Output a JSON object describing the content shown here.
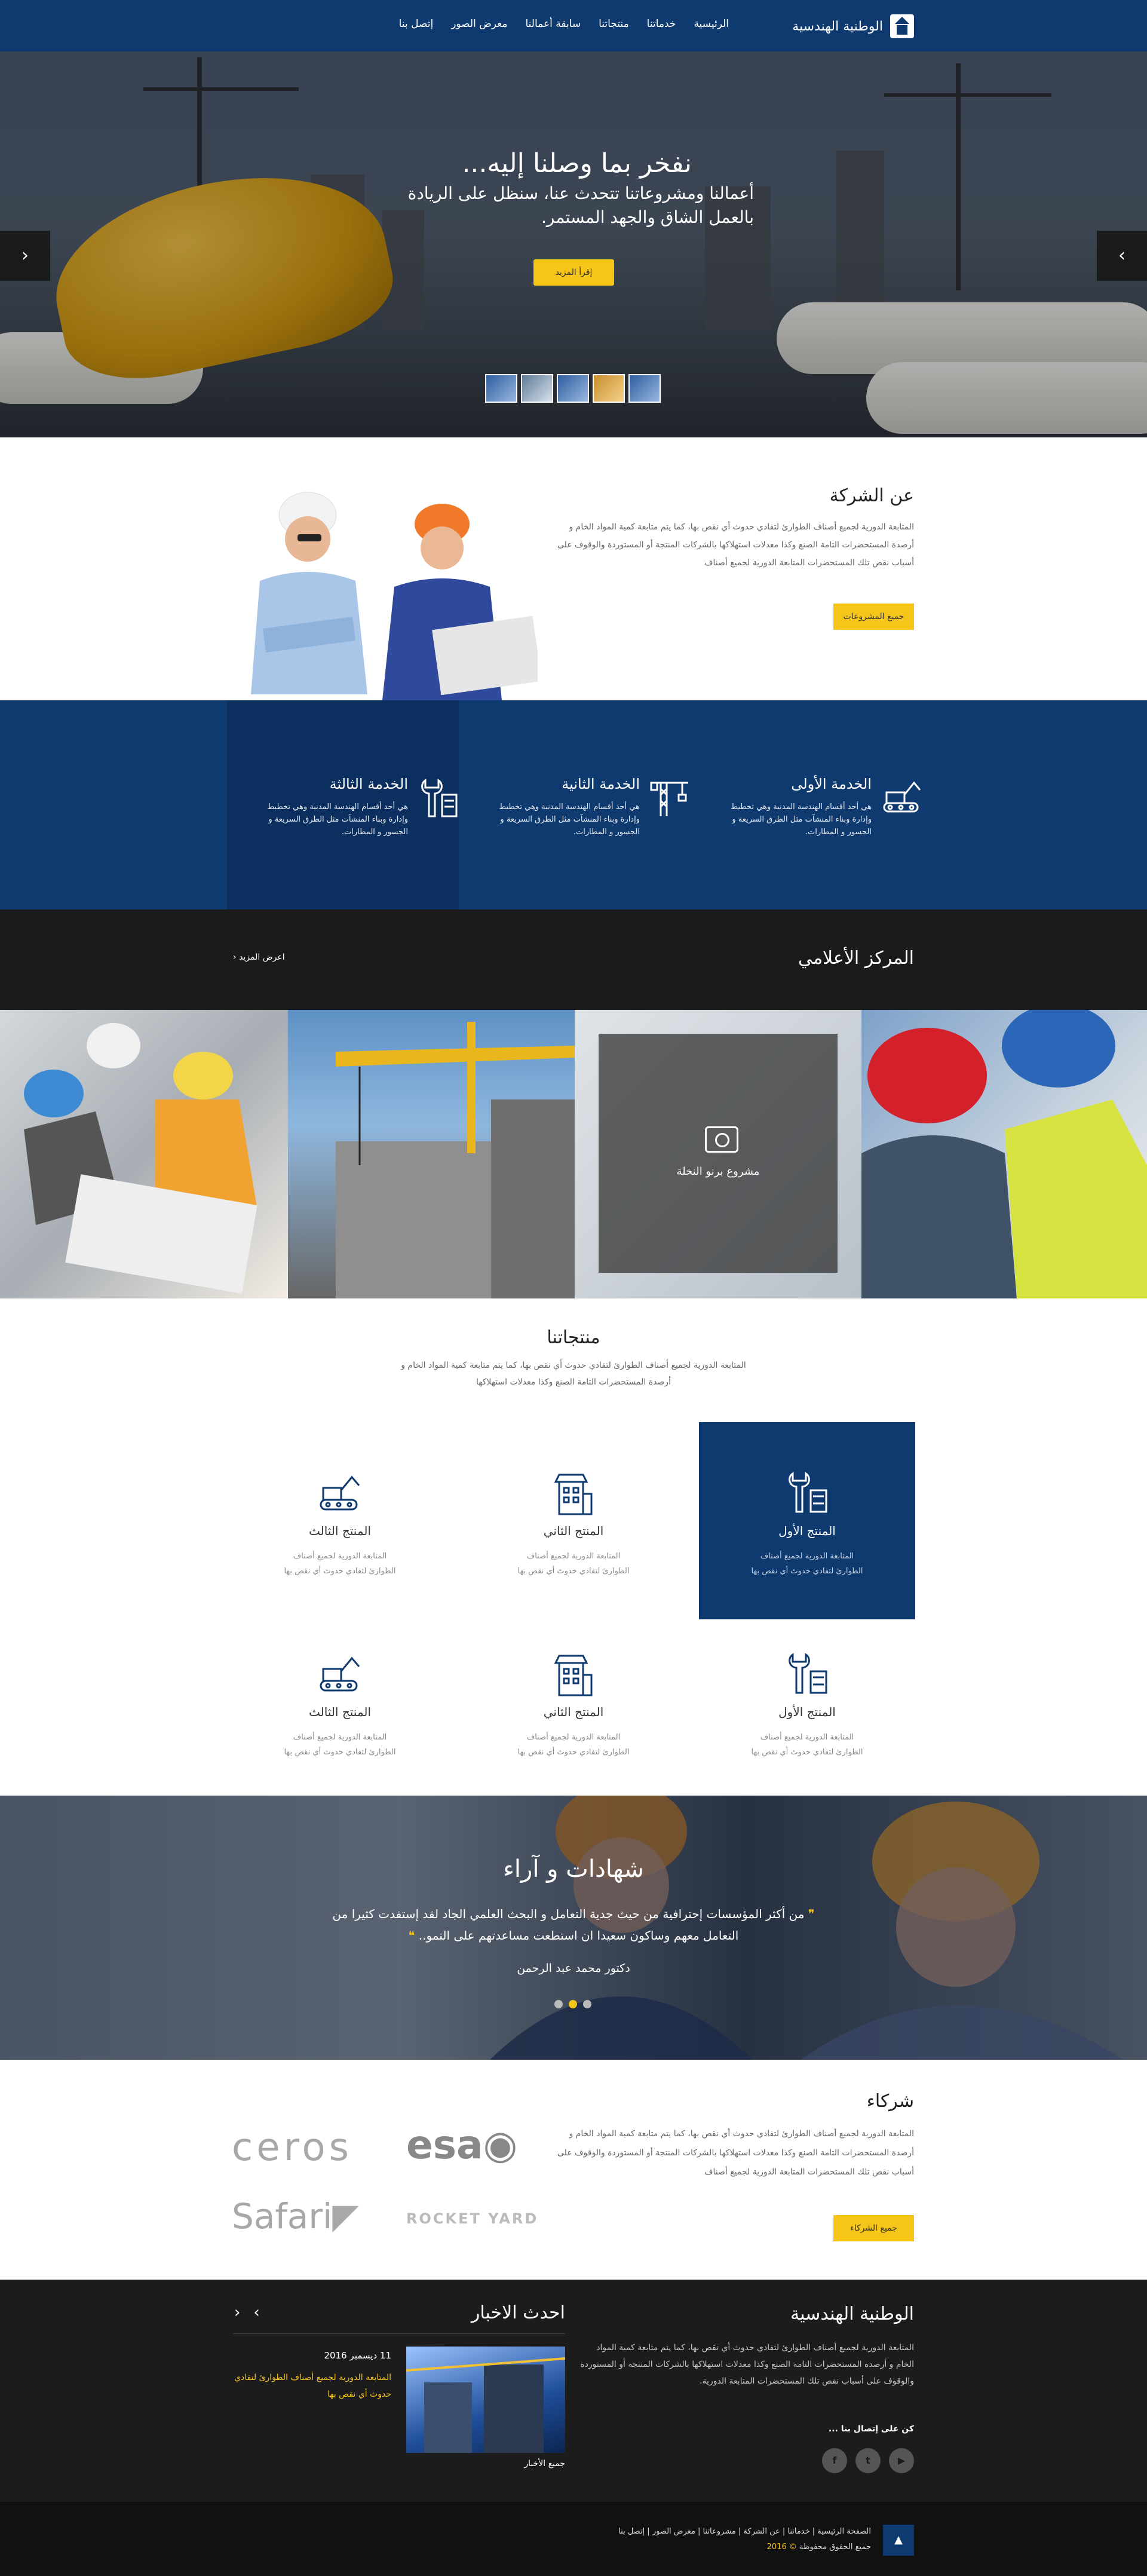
{
  "nav": {
    "brand": "الوطنية الهندسية",
    "items": [
      "الرئيسية",
      "خدماتنا",
      "منتجاتنا",
      "سابقة أعمالنا",
      "معرض الصور",
      "إتصل بنا"
    ]
  },
  "hero": {
    "title": "نفخر بما وصلنا إليه...",
    "subtitle": "أعمالنا ومشروعاتنا تتحدث عنا، سنظل على الريادة بالعمل الشاق والجهد المستمر.",
    "button": "إقرأ المزيد",
    "arrow_prev": "‹",
    "arrow_next": "›"
  },
  "about": {
    "title": "عن الشركة",
    "text": "المتابعة الدورية لجميع أصناف الطوارئ لتفادي حدوث أي نقص بها، كما يتم متابعة كمية المواد الخام و أرصدة المستحضرات التامة الصنع وكذا معدلات استهلاكها بالشركات المنتجة أو المستوردة والوقوف على أسباب نقص تلك المستحضرات المتابعة الدورية لجميع أصناف",
    "button": "جميع المشروعات"
  },
  "services": [
    {
      "title": "الخدمة الأولى",
      "text": "هي أحد أقسام الهندسة المدنية وهي تخطيط وإدارة وبناء المنشآت مثل الطرق السريعة و الجسور و المطارات."
    },
    {
      "title": "الخدمة الثانية",
      "text": "هي أحد أقسام الهندسة المدنية وهي تخطيط وإدارة وبناء المنشآت مثل الطرق السريعة و الجسور و المطارات."
    },
    {
      "title": "الخدمة الثالثة",
      "text": "هي أحد أقسام الهندسة المدنية وهي تخطيط وإدارة وبناء المنشآت مثل الطرق السريعة و الجسور و المطارات."
    }
  ],
  "media": {
    "title": "المركز الأعلامي",
    "more": "اعرض المزيد",
    "overlay_label": "مشروع برنو النخلة"
  },
  "products": {
    "title": "منتجاتنا",
    "intro": "المتابعة الدورية لجميع أصناف الطوارئ لتفادي حدوث أي نقص بها، كما يتم متابعة كمية المواد الخام و أرصدة المستحضرات التامة الصنع وكذا معدلات استهلاكها",
    "items": [
      {
        "title": "المنتج الأول",
        "text": "المتابعة الدورية لجميع أصناف الطوارئ لتفادي حدوث أي نقص بها"
      },
      {
        "title": "المنتج الثاني",
        "text": "المتابعة الدورية لجميع أصناف الطوارئ لتفادي حدوث أي نقص بها"
      },
      {
        "title": "المنتج الثالث",
        "text": "المتابعة الدورية لجميع أصناف الطوارئ لتفادي حدوث أي نقص بها"
      },
      {
        "title": "المنتج الأول",
        "text": "المتابعة الدورية لجميع أصناف الطوارئ لتفادي حدوث أي نقص بها"
      },
      {
        "title": "المنتج الثاني",
        "text": "المتابعة الدورية لجميع أصناف الطوارئ لتفادي حدوث أي نقص بها"
      },
      {
        "title": "المنتج الثالث",
        "text": "المتابعة الدورية لجميع أصناف الطوارئ لتفادي حدوث أي نقص بها"
      }
    ]
  },
  "testimonials": {
    "title": "شهادات و آراء",
    "quote": "من أكثر المؤسسات إحترافية من حيث جدية التعامل و البحث العلمي الجاد لقد إستفدت كثيرا من التعامل معهم وساكون سعيدا ان استطعت مساعدتهم على النمو..",
    "author": "دكتور محمد عبد الرحمن"
  },
  "partners": {
    "title": "شركاء",
    "text": "المتابعة الدورية لجميع أصناف الطوارئ لتفادي حدوث أي نقص بها، كما يتم متابعة كمية المواد الخام و أرصدة المستحضرات التامة الصنع وكذا معدلات استهلاكها بالشركات المنتجة أو المستوردة والوقوف على أسباب نقص تلك المستحضرات المتابعة الدورية لجميع أصناف",
    "button": "جميع الشركاء",
    "logos": [
      "ceros",
      "esa",
      "Safari",
      "ROCKET YARD"
    ]
  },
  "footer": {
    "title": "الوطنية الهندسية",
    "text": "المتابعة الدورية لجميع أصناف الطوارئ لتفادي حدوث أي نقص بها، كما يتم متابعة كمية المواد الخام و أرصدة المستحضرات التامة الصنع وكذا معدلات استهلاكها بالشركات المنتجة أو المستوردة والوقوف على أسباب نقص تلك المستحضرات المتابعة الدورية.",
    "follow": "كن على إتصال بنا ...",
    "news_title": "احدث الاخبار",
    "news_date": "11 ديسمبر 2016",
    "news_text": "المتابعة الدورية لجميع أصناف الطوارئ لتفادي حدوث أي نقص بها",
    "all_news": "جميع الأخبار"
  },
  "bottom": {
    "links": "الصفحة الرئيسية | خدماتنا | عن الشركة | مشروعاتنا | معرض الصور | إتصل بنا",
    "copy": "جميع الحقوق محفوظة",
    "year": "© 2016"
  },
  "colors": {
    "primary": "#0e3a70",
    "accent": "#f6c51a",
    "dark": "#1c1c1c"
  }
}
